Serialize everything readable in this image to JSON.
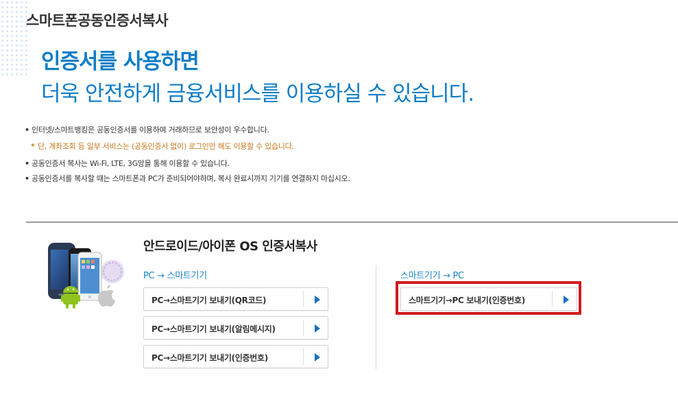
{
  "page": {
    "title": "스마트폰공동인증서복사"
  },
  "hero": {
    "line1": "인증서를 사용하면",
    "line2": "더욱 안전하게 금융서비스를 이용하실 수 있습니다."
  },
  "notes": [
    {
      "bullet": "•",
      "text": "인터넷/스마트뱅킹은 공동인증서를 이용하여 거래하므로 보안성이 우수합니다."
    },
    {
      "bullet": "*",
      "text": "단, 계좌조회 등 일부 서비스는 (공동인증서 없이) 로그인만 해도 이용할 수 있습니다."
    },
    {
      "bullet": "•",
      "text": "공동인증서 복사는 Wi-Fi, LTE, 3G망을 통해 이용할 수 있습니다."
    },
    {
      "bullet": "•",
      "text": "공동인증서를 복사할 때는 스마트폰과 PC가 준비되어야하며, 복사 완료시까지 기기를 연결하지 마십시오."
    }
  ],
  "section": {
    "title": "안드로이드/아이폰 OS 인증서복사",
    "left_column": {
      "label": "PC → 스마트기기",
      "buttons": [
        {
          "label": "PC→스마트기기 보내기(QR코드)"
        },
        {
          "label": "PC→스마트기기 보내기(알림메시지)"
        },
        {
          "label": "PC→스마트기기 보내기(인증번호)"
        }
      ]
    },
    "right_column": {
      "label": "스마트기기 → PC",
      "buttons": [
        {
          "label": "스마트기기→PC 보내기(인증번호)"
        }
      ]
    }
  },
  "icons": {
    "button_arrow": "arrow-right-icon",
    "illustration": "smartphones-illustration"
  },
  "colors": {
    "hero": "#0f7dc6",
    "accent_blue": "#1a84c8",
    "note_highlight": "#c8761c",
    "highlight_border": "#d11a1f"
  }
}
